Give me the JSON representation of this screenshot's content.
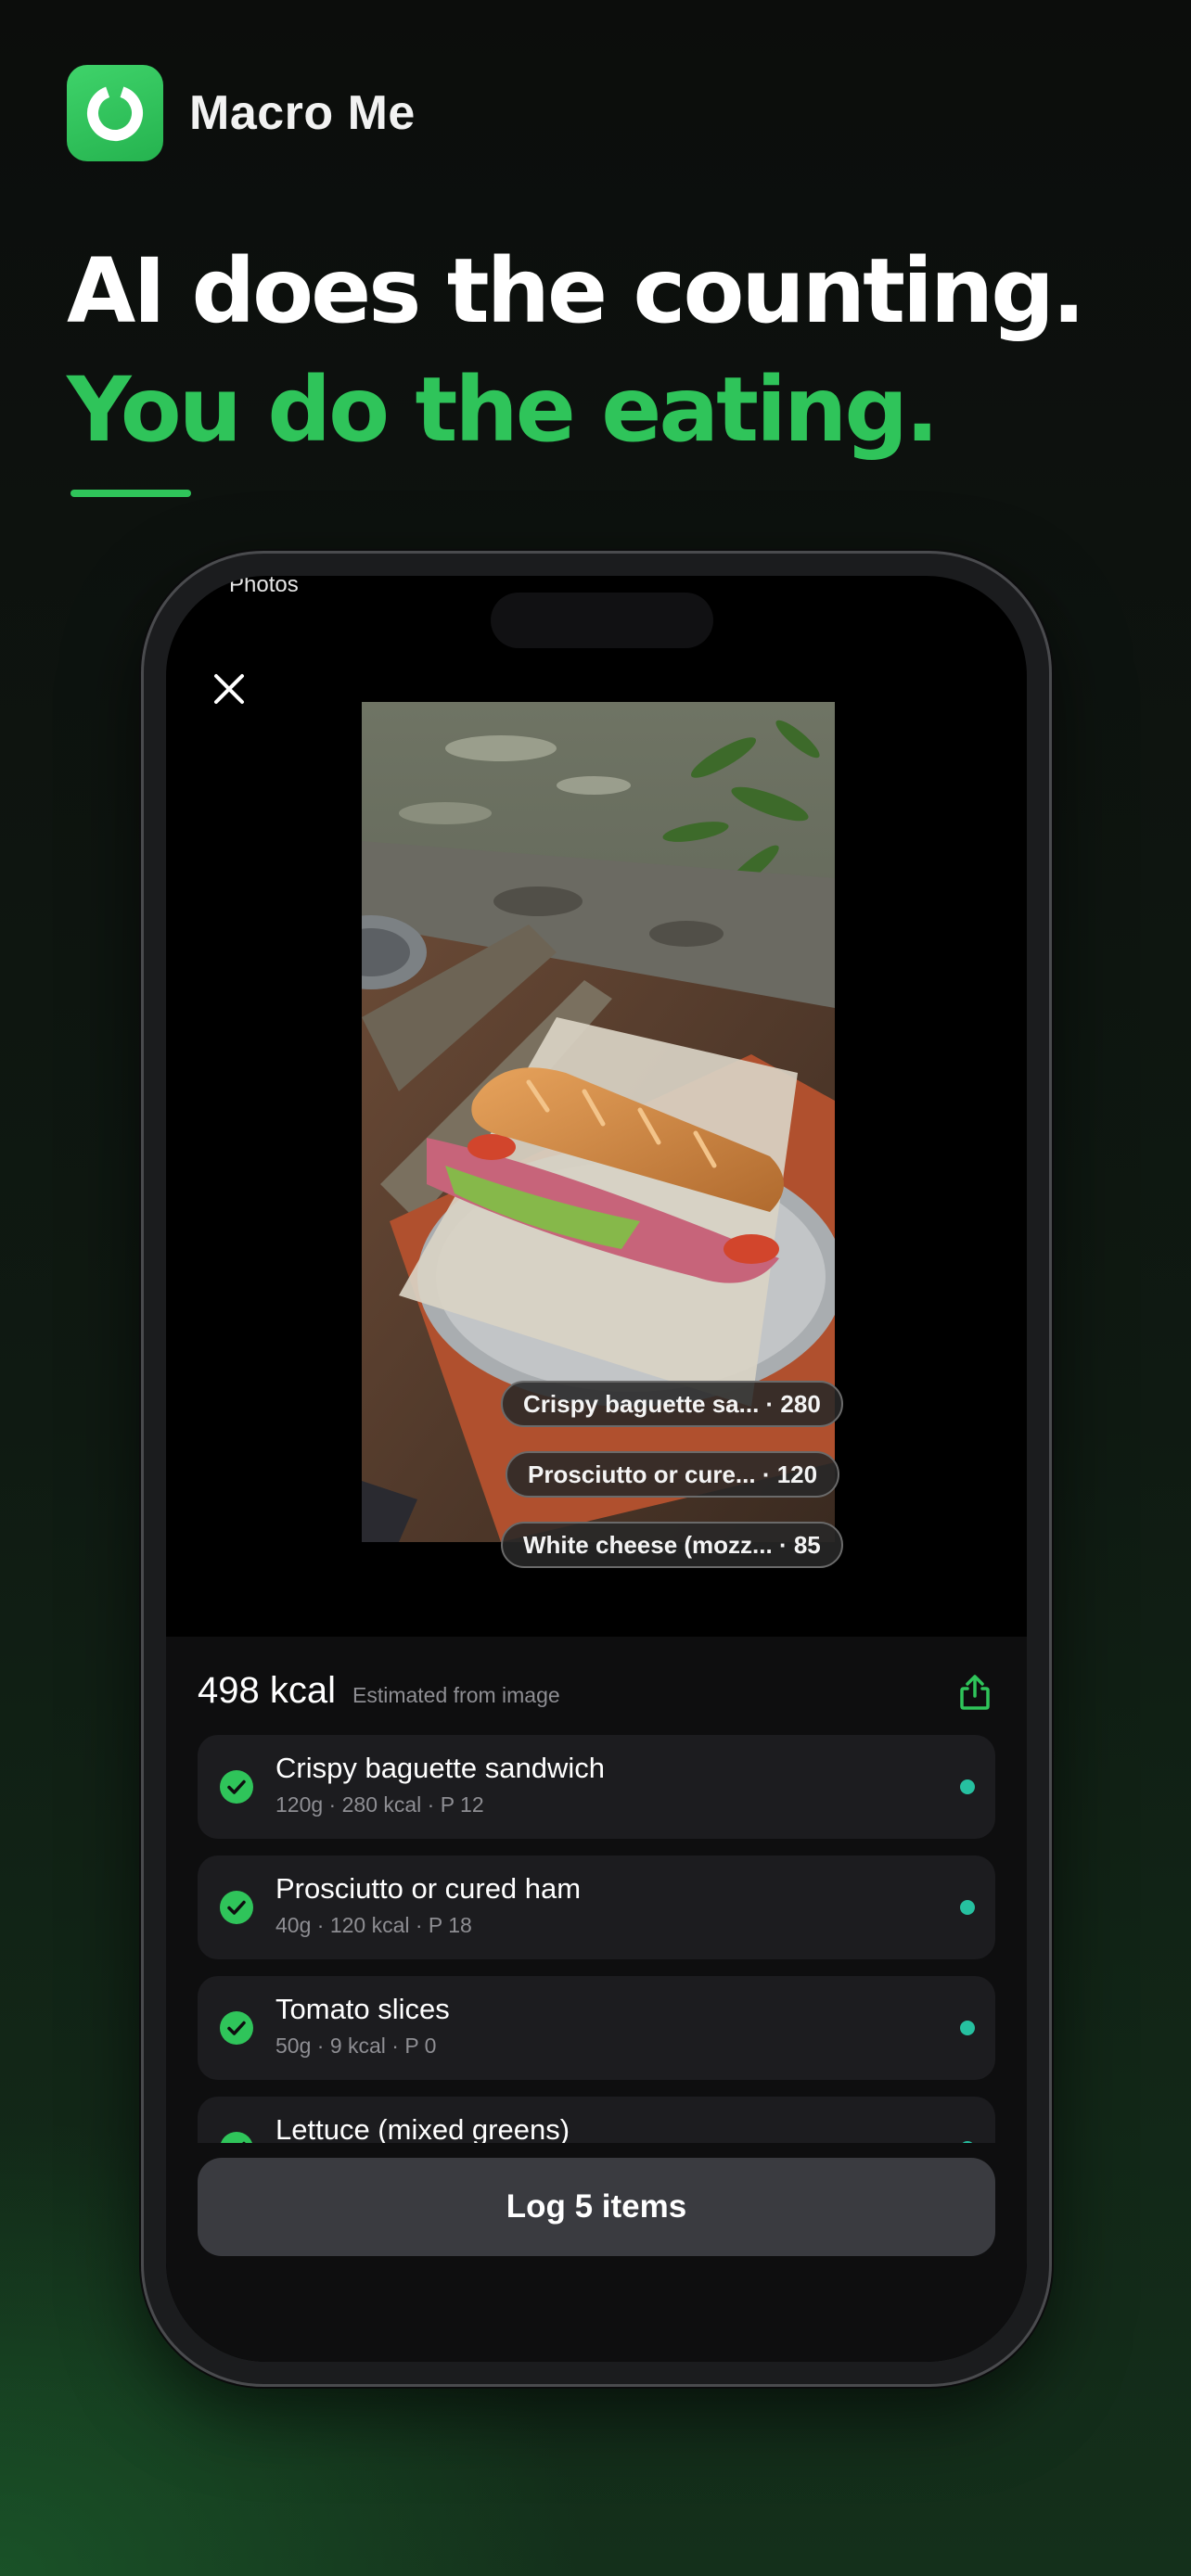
{
  "brand": {
    "name": "Macro Me",
    "icon": "ring-logo-icon",
    "accent_color": "#2fc45a"
  },
  "headline": {
    "line1": "AI does the counting.",
    "line2": "You do the eating."
  },
  "phone": {
    "status_text": "Photos",
    "close_icon": "close-icon",
    "detections": [
      {
        "label": "Crispy baguette sa... · 280"
      },
      {
        "label": "Prosciutto or cure... · 120"
      },
      {
        "label": "White cheese (mozz... · 85"
      }
    ],
    "summary": {
      "total_kcal": "498 kcal",
      "note": "Estimated from image",
      "share_icon": "share-icon"
    },
    "items": [
      {
        "name": "Crispy baguette sandwich",
        "meta": "120g · 280 kcal · P 12",
        "checked": true,
        "dot_color": "#26c0a0"
      },
      {
        "name": "Prosciutto or cured ham",
        "meta": "40g · 120 kcal · P 18",
        "checked": true,
        "dot_color": "#26c0a0"
      },
      {
        "name": "Tomato slices",
        "meta": "50g · 9 kcal · P 0",
        "checked": true,
        "dot_color": "#26c0a0"
      },
      {
        "name": "Lettuce (mixed greens)",
        "meta": "",
        "checked": true,
        "dot_color": "#26c0a0"
      }
    ],
    "log_button": "Log 5 items"
  }
}
